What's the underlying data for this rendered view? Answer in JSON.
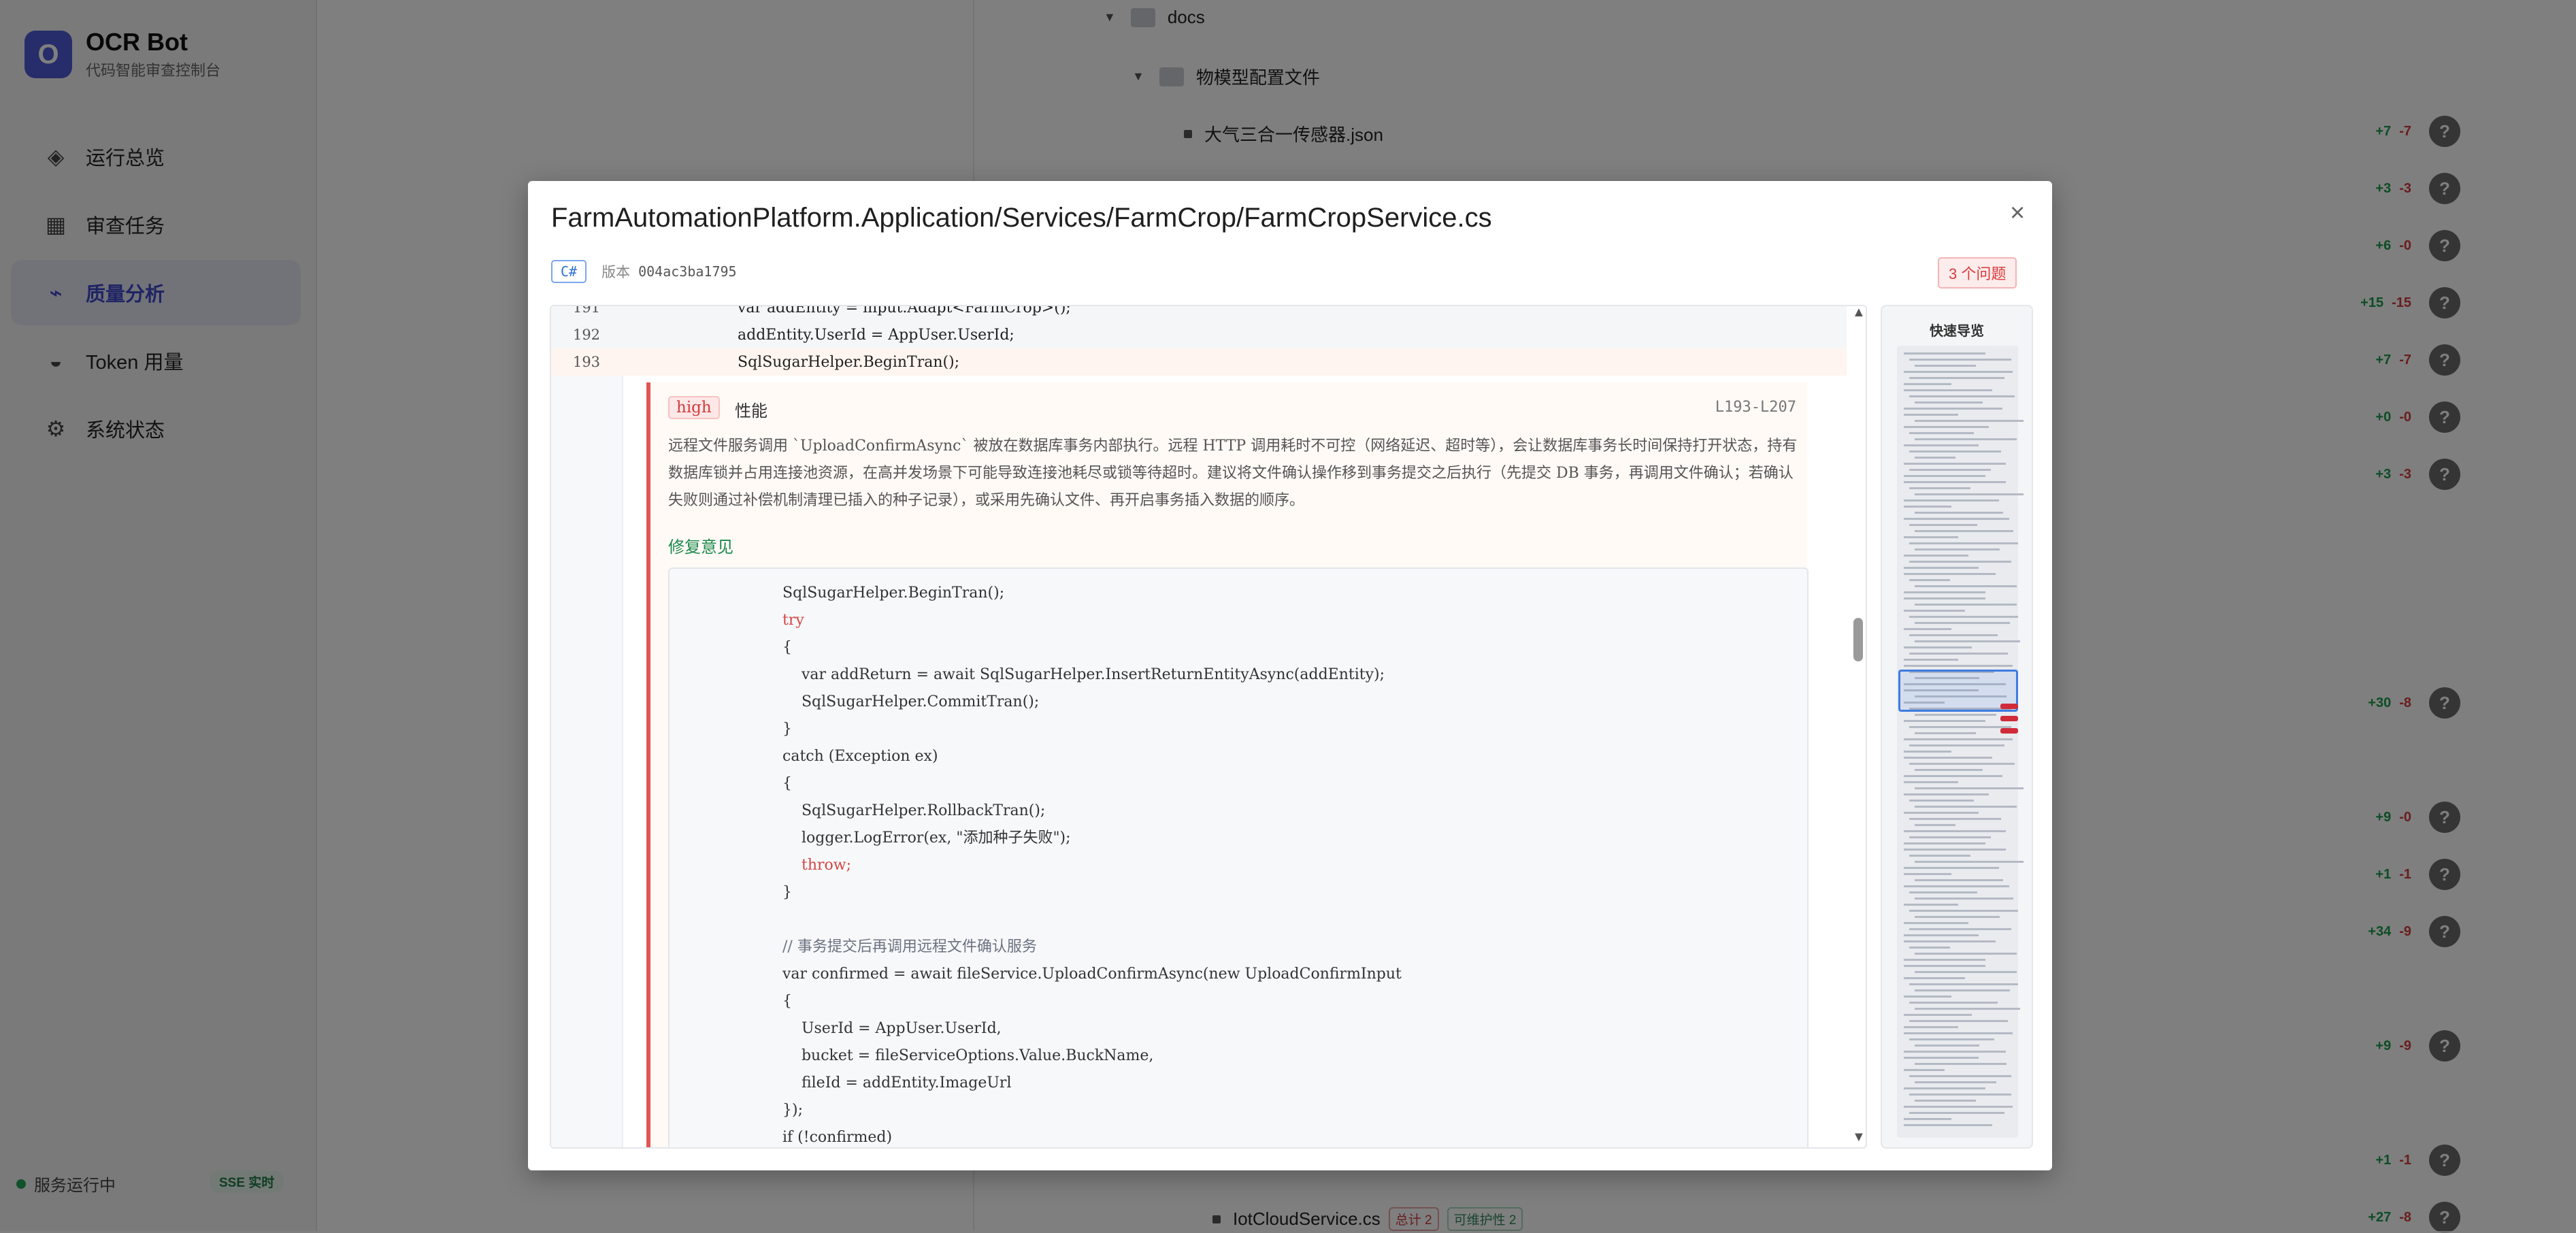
{
  "app": {
    "name": "OCR Bot",
    "subtitle": "代码智能审查控制台",
    "logo_letter": "O",
    "accent": "#4f5bd5"
  },
  "sidebar": {
    "items": [
      {
        "label": "运行总览",
        "icon": "diamond-icon"
      },
      {
        "label": "审查任务",
        "icon": "grid-icon"
      },
      {
        "label": "质量分析",
        "icon": "trend-icon",
        "active": true
      },
      {
        "label": "Token 用量",
        "icon": "half-circle-icon"
      },
      {
        "label": "系统状态",
        "icon": "gear-icon"
      }
    ],
    "status_text": "服务运行中",
    "sse_badge": "SSE 实时"
  },
  "tree": {
    "folder_docs": "docs",
    "folder_models": "物模型配置文件",
    "file_first": "大气三合一传感器.json",
    "file_last": "IotCloudService.cs",
    "file_last_badges": [
      "总计 2",
      "可维护性 2"
    ],
    "stats": [
      {
        "add": "+7",
        "del": "-7"
      },
      {
        "add": "+3",
        "del": "-3"
      },
      {
        "add": "+6",
        "del": "-0"
      },
      {
        "add": "+15",
        "del": "-15"
      },
      {
        "add": "+7",
        "del": "-7"
      },
      {
        "add": "+0",
        "del": "-0"
      },
      {
        "add": "+3",
        "del": "-3"
      },
      {
        "add": "+30",
        "del": "-8"
      },
      {
        "add": "+9",
        "del": "-0"
      },
      {
        "add": "+1",
        "del": "-1"
      },
      {
        "add": "+34",
        "del": "-9"
      },
      {
        "add": "+9",
        "del": "-9"
      },
      {
        "add": "+1",
        "del": "-1"
      },
      {
        "add": "+27",
        "del": "-8"
      }
    ],
    "question_glyph": "?"
  },
  "modal": {
    "title": "FarmAutomationPlatform.Application/Services/FarmCrop/FarmCropService.cs",
    "close_glyph": "×",
    "language": "C#",
    "version_label": "版本",
    "version_value": "004ac3ba1795",
    "issue_count": "3 个问题",
    "code_lines": [
      {
        "num": "191",
        "text": "var addEntity = input.Adapt<FarmCrop>();"
      },
      {
        "num": "192",
        "text": "addEntity.UserId = AppUser.UserId;"
      },
      {
        "num": "193",
        "text": "SqlSugarHelper.BeginTran();"
      }
    ],
    "issue": {
      "severity": "high",
      "category": "性能",
      "range": "L193-L207",
      "description": "远程文件服务调用 `UploadConfirmAsync` 被放在数据库事务内部执行。远程 HTTP 调用耗时不可控（网络延迟、超时等），会让数据库事务长时间保持打开状态，持有数据库锁并占用连接池资源，在高并发场景下可能导致连接池耗尽或锁等待超时。建议将文件确认操作移到事务提交之后执行（先提交 DB 事务，再调用文件确认；若确认失败则通过补偿机制清理已插入的种子记录），或采用先确认文件、再开启事务插入数据的顺序。",
      "fix_label": "修复意见",
      "fix_code": [
        "SqlSugarHelper.BeginTran();",
        "try",
        "{",
        "    var addReturn = await SqlSugarHelper.InsertReturnEntityAsync(addEntity);",
        "    SqlSugarHelper.CommitTran();",
        "}",
        "catch (Exception ex)",
        "{",
        "    SqlSugarHelper.RollbackTran();",
        "    logger.LogError(ex, \"添加种子失败\");",
        "    throw;",
        "}",
        "",
        "// 事务提交后再调用远程文件确认服务",
        "var confirmed = await fileService.UploadConfirmAsync(new UploadConfirmInput",
        "{",
        "    UserId = AppUser.UserId,",
        "    bucket = fileServiceOptions.Value.BuckName,",
        "    fileId = addEntity.ImageUrl",
        "});",
        "if (!confirmed)"
      ]
    },
    "quicknav_title": "快速导览",
    "scroll_up_glyph": "▲",
    "scroll_down_glyph": "▼"
  }
}
